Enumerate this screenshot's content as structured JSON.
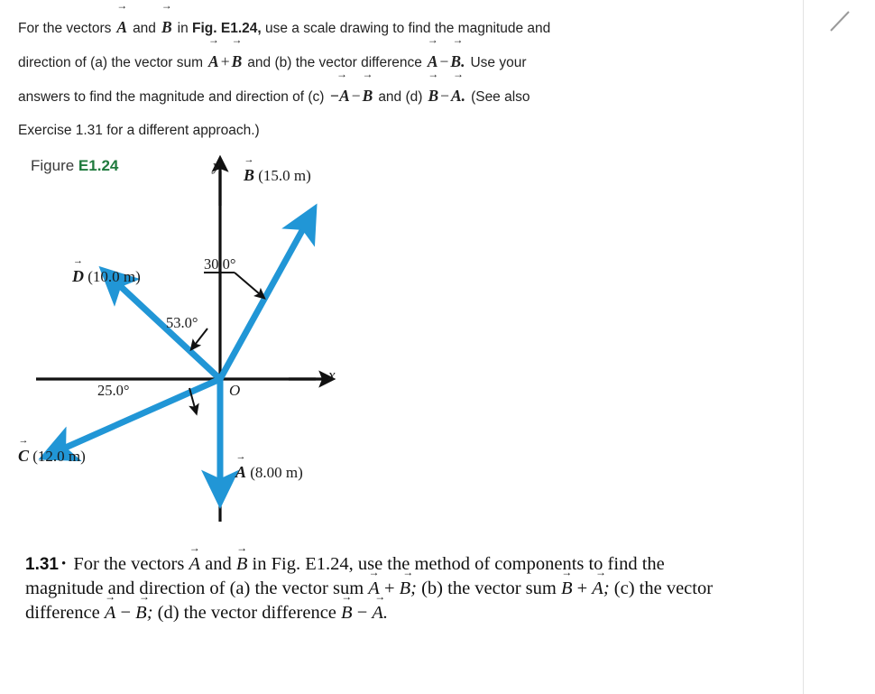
{
  "statement": {
    "line1_a": "For the vectors",
    "line1_A": "A",
    "line1_and": "and",
    "line1_B": "B",
    "line1_in": "in",
    "line1_fig": "Fig. E1.24,",
    "line1_rest": "use a scale drawing to find the magnitude and",
    "line2_a": "direction of (a) the vector sum",
    "line2_A": "A",
    "line2_plus": "+",
    "line2_B": "B",
    "line2_mid": "and (b) the vector difference",
    "line2_A2": "A",
    "line2_minus": "−",
    "line2_B2": "B.",
    "line2_end": "Use your",
    "line3_a": "answers to find the magnitude and direction of (c)",
    "line3_negA": "−A",
    "line3_minus": "−",
    "line3_B": "B",
    "line3_mid": "and (d)",
    "line3_B2": "B",
    "line3_minus2": "−",
    "line3_A2": "A.",
    "line3_end": "(See also",
    "line4": "Exercise 1.31 for a different approach.)"
  },
  "figure": {
    "caption_word": "Figure",
    "caption_number": "E1.24",
    "axis_x": "x",
    "axis_y": "y",
    "origin": "O",
    "vectors": [
      {
        "name": "B",
        "label_symbol": "B",
        "label_value": "(15.0 m)"
      },
      {
        "name": "D",
        "label_symbol": "D",
        "label_value": "(10.0 m)"
      },
      {
        "name": "C",
        "label_symbol": "C",
        "label_value": "(12.0 m)"
      },
      {
        "name": "A",
        "label_symbol": "A",
        "label_value": "(8.00 m)"
      }
    ],
    "angles": [
      {
        "name": "angle-B",
        "text": "30.0°"
      },
      {
        "name": "angle-D",
        "text": "53.0°"
      },
      {
        "name": "angle-C",
        "text": "25.0°"
      }
    ],
    "accent_color": "#2196d6"
  },
  "exercise": {
    "number": "1.31",
    "bullet": "•",
    "t1": "For the vectors",
    "A1": "A",
    "t2": "and",
    "B1": "B",
    "t3": "in Fig. E1.24, use the method of",
    "t4": "components to find the magnitude and direction of (a) the vector",
    "t5": "sum",
    "A2": "A",
    "plus1": "+",
    "B2": "B;",
    "t6": "(b) the vector sum",
    "B3": "B",
    "plus2": "+",
    "A3": "A;",
    "t7": "(c) the vector difference",
    "A4": "A",
    "minus1": "−",
    "B4": "B;",
    "t8": "(d) the vector difference",
    "B5": "B",
    "minus2": "−",
    "A5": "A."
  }
}
